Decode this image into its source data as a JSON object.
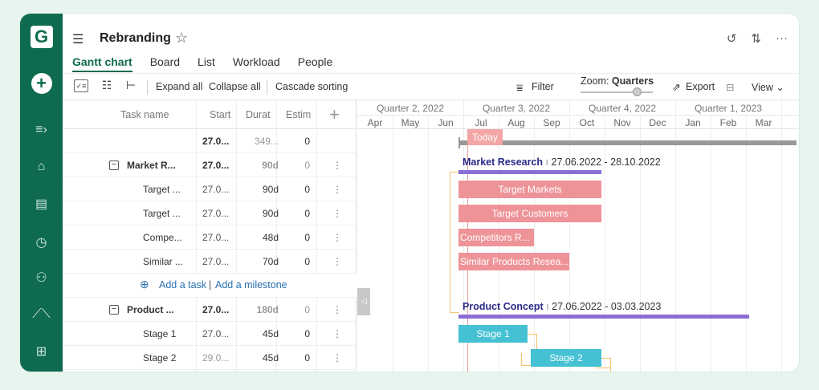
{
  "app": {
    "logo": "G",
    "plus": "+"
  },
  "sidebar_icons": [
    "expand-icon",
    "home-icon",
    "projects-icon",
    "clock-icon",
    "people-icon",
    "analytics-icon",
    "apps-icon"
  ],
  "project": {
    "title": "Rebranding",
    "star": "☆"
  },
  "tabs": [
    "Gantt chart",
    "Board",
    "List",
    "Workload",
    "People"
  ],
  "toolbar": {
    "expand_all": "Expand all",
    "collapse_all": "Collapse all",
    "cascade_sorting": "Cascade sorting",
    "filter": "Filter",
    "zoom_label": "Zoom:",
    "zoom_value": "Quarters",
    "export": "Export",
    "view": "View"
  },
  "grid": {
    "headers": {
      "name": "Task name",
      "start": "Start",
      "duration": "Durat",
      "estimate": "Estim",
      "add": "+"
    },
    "rows": [
      {
        "name": "",
        "start": "27.0...",
        "duration": "349...",
        "estimate": "0",
        "menu": ""
      },
      {
        "name": "Market R...",
        "start": "27.0...",
        "duration": "90d",
        "estimate": "0",
        "menu": "⋮"
      },
      {
        "name": "Target ...",
        "start": "27.0...",
        "duration": "90d",
        "estimate": "0",
        "menu": "⋮"
      },
      {
        "name": "Target ...",
        "start": "27.0...",
        "duration": "90d",
        "estimate": "0",
        "menu": "⋮"
      },
      {
        "name": "Compe...",
        "start": "27.0...",
        "duration": "48d",
        "estimate": "0",
        "menu": "⋮"
      },
      {
        "name": "Similar ...",
        "start": "27.0...",
        "duration": "70d",
        "estimate": "0",
        "menu": "⋮"
      },
      {
        "name": "Product ...",
        "start": "27.0...",
        "duration": "180d",
        "estimate": "0",
        "menu": "⋮"
      },
      {
        "name": "Stage 1",
        "start": "27.0...",
        "duration": "45d",
        "estimate": "0",
        "menu": "⋮"
      },
      {
        "name": "Stage 2",
        "start": "29.0...",
        "duration": "45d",
        "estimate": "0",
        "menu": "⋮"
      }
    ],
    "add_task": "Add a task",
    "add_separator": "|",
    "add_milestone": "Add a milestone"
  },
  "timeline": {
    "quarters": [
      "Quarter 2, 2022",
      "Quarter 3, 2022",
      "Quarter 4, 2022",
      "Quarter 1, 2023"
    ],
    "months": [
      "Apr",
      "May",
      "Jun",
      "Jul",
      "Aug",
      "Sep",
      "Oct",
      "Nov",
      "Dec",
      "Jan",
      "Feb",
      "Mar"
    ],
    "today": "Today",
    "groups": [
      {
        "name": "Market Research",
        "dates": "27.06.2022 - 28.10.2022"
      },
      {
        "name": "Product Concept",
        "dates": "27.06.2022 - 03.03.2023"
      }
    ],
    "bars": [
      "Target Markets",
      "Target Customers",
      "Competitors R...",
      "Similar Products Resea...",
      "Stage 1",
      "Stage 2"
    ],
    "split_handle": "◁"
  },
  "colors": {
    "brand": "#0e6b50",
    "task_bar": "#ee9499",
    "stage_bar": "#45c1d4",
    "summary_bar": "#8b6dd7",
    "today": "#f4a5a5",
    "link": "#2a6fb0"
  }
}
